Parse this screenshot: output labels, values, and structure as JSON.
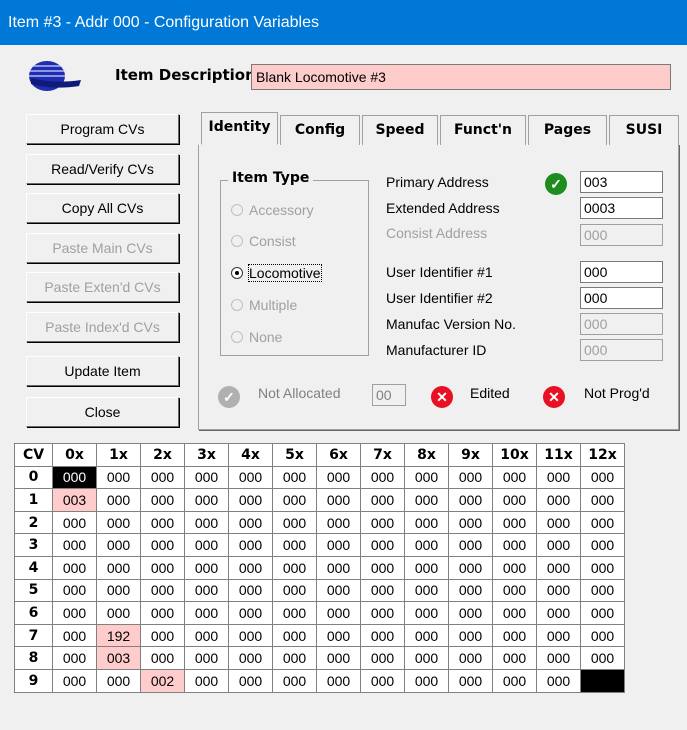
{
  "window": {
    "title": "Item #3 - Addr 000 - Configuration Variables"
  },
  "header": {
    "desc_label": "Item Description",
    "desc_value": "Blank Locomotive #3"
  },
  "buttons": {
    "program": "Program CVs",
    "read_verify": "Read/Verify CVs",
    "copy_all": "Copy All CVs",
    "paste_main": "Paste Main CVs",
    "paste_extend": "Paste Exten'd CVs",
    "paste_index": "Paste Index'd CVs",
    "update": "Update Item",
    "close": "Close"
  },
  "tabs": [
    "Identity",
    "Config",
    "Speed",
    "Funct'n",
    "Pages",
    "SUSI"
  ],
  "item_type": {
    "title": "Item Type",
    "options": [
      "Accessory",
      "Consist",
      "Locomotive",
      "Multiple",
      "None"
    ],
    "selected": "Locomotive"
  },
  "fields": {
    "primary_address_label": "Primary Address",
    "primary_address": "003",
    "extended_address_label": "Extended Address",
    "extended_address": "0003",
    "consist_address_label": "Consist Address",
    "consist_address": "000",
    "user_id1_label": "User Identifier #1",
    "user_id1": "000",
    "user_id2_label": "User Identifier #2",
    "user_id2": "000",
    "manufac_version_label": "Manufac Version No.",
    "manufac_version": "000",
    "manufacturer_id_label": "Manufacturer ID",
    "manufacturer_id": "000"
  },
  "status": {
    "not_allocated_label": "Not Allocated",
    "not_allocated_value": "00",
    "edited_label": "Edited",
    "not_progd_label": "Not Prog'd"
  },
  "colors": {
    "titlebar": "#0078d7",
    "edited_pink": "#ffcccc",
    "ok_green": "#1e8c1e",
    "error_red": "#e81123"
  },
  "cv_grid": {
    "corner": "CV",
    "columns": [
      "0x",
      "1x",
      "2x",
      "3x",
      "4x",
      "5x",
      "6x",
      "7x",
      "8x",
      "9x",
      "10x",
      "11x",
      "12x"
    ],
    "rows": [
      {
        "cv": "0",
        "values": [
          "000",
          "000",
          "000",
          "000",
          "000",
          "000",
          "000",
          "000",
          "000",
          "000",
          "000",
          "000",
          "000"
        ]
      },
      {
        "cv": "1",
        "values": [
          "003",
          "000",
          "000",
          "000",
          "000",
          "000",
          "000",
          "000",
          "000",
          "000",
          "000",
          "000",
          "000"
        ]
      },
      {
        "cv": "2",
        "values": [
          "000",
          "000",
          "000",
          "000",
          "000",
          "000",
          "000",
          "000",
          "000",
          "000",
          "000",
          "000",
          "000"
        ]
      },
      {
        "cv": "3",
        "values": [
          "000",
          "000",
          "000",
          "000",
          "000",
          "000",
          "000",
          "000",
          "000",
          "000",
          "000",
          "000",
          "000"
        ]
      },
      {
        "cv": "4",
        "values": [
          "000",
          "000",
          "000",
          "000",
          "000",
          "000",
          "000",
          "000",
          "000",
          "000",
          "000",
          "000",
          "000"
        ]
      },
      {
        "cv": "5",
        "values": [
          "000",
          "000",
          "000",
          "000",
          "000",
          "000",
          "000",
          "000",
          "000",
          "000",
          "000",
          "000",
          "000"
        ]
      },
      {
        "cv": "6",
        "values": [
          "000",
          "000",
          "000",
          "000",
          "000",
          "000",
          "000",
          "000",
          "000",
          "000",
          "000",
          "000",
          "000"
        ]
      },
      {
        "cv": "7",
        "values": [
          "000",
          "192",
          "000",
          "000",
          "000",
          "000",
          "000",
          "000",
          "000",
          "000",
          "000",
          "000",
          "000"
        ]
      },
      {
        "cv": "8",
        "values": [
          "000",
          "003",
          "000",
          "000",
          "000",
          "000",
          "000",
          "000",
          "000",
          "000",
          "000",
          "000",
          "000"
        ]
      },
      {
        "cv": "9",
        "values": [
          "000",
          "000",
          "002",
          "000",
          "000",
          "000",
          "000",
          "000",
          "000",
          "000",
          "000",
          "000",
          ""
        ]
      }
    ]
  }
}
